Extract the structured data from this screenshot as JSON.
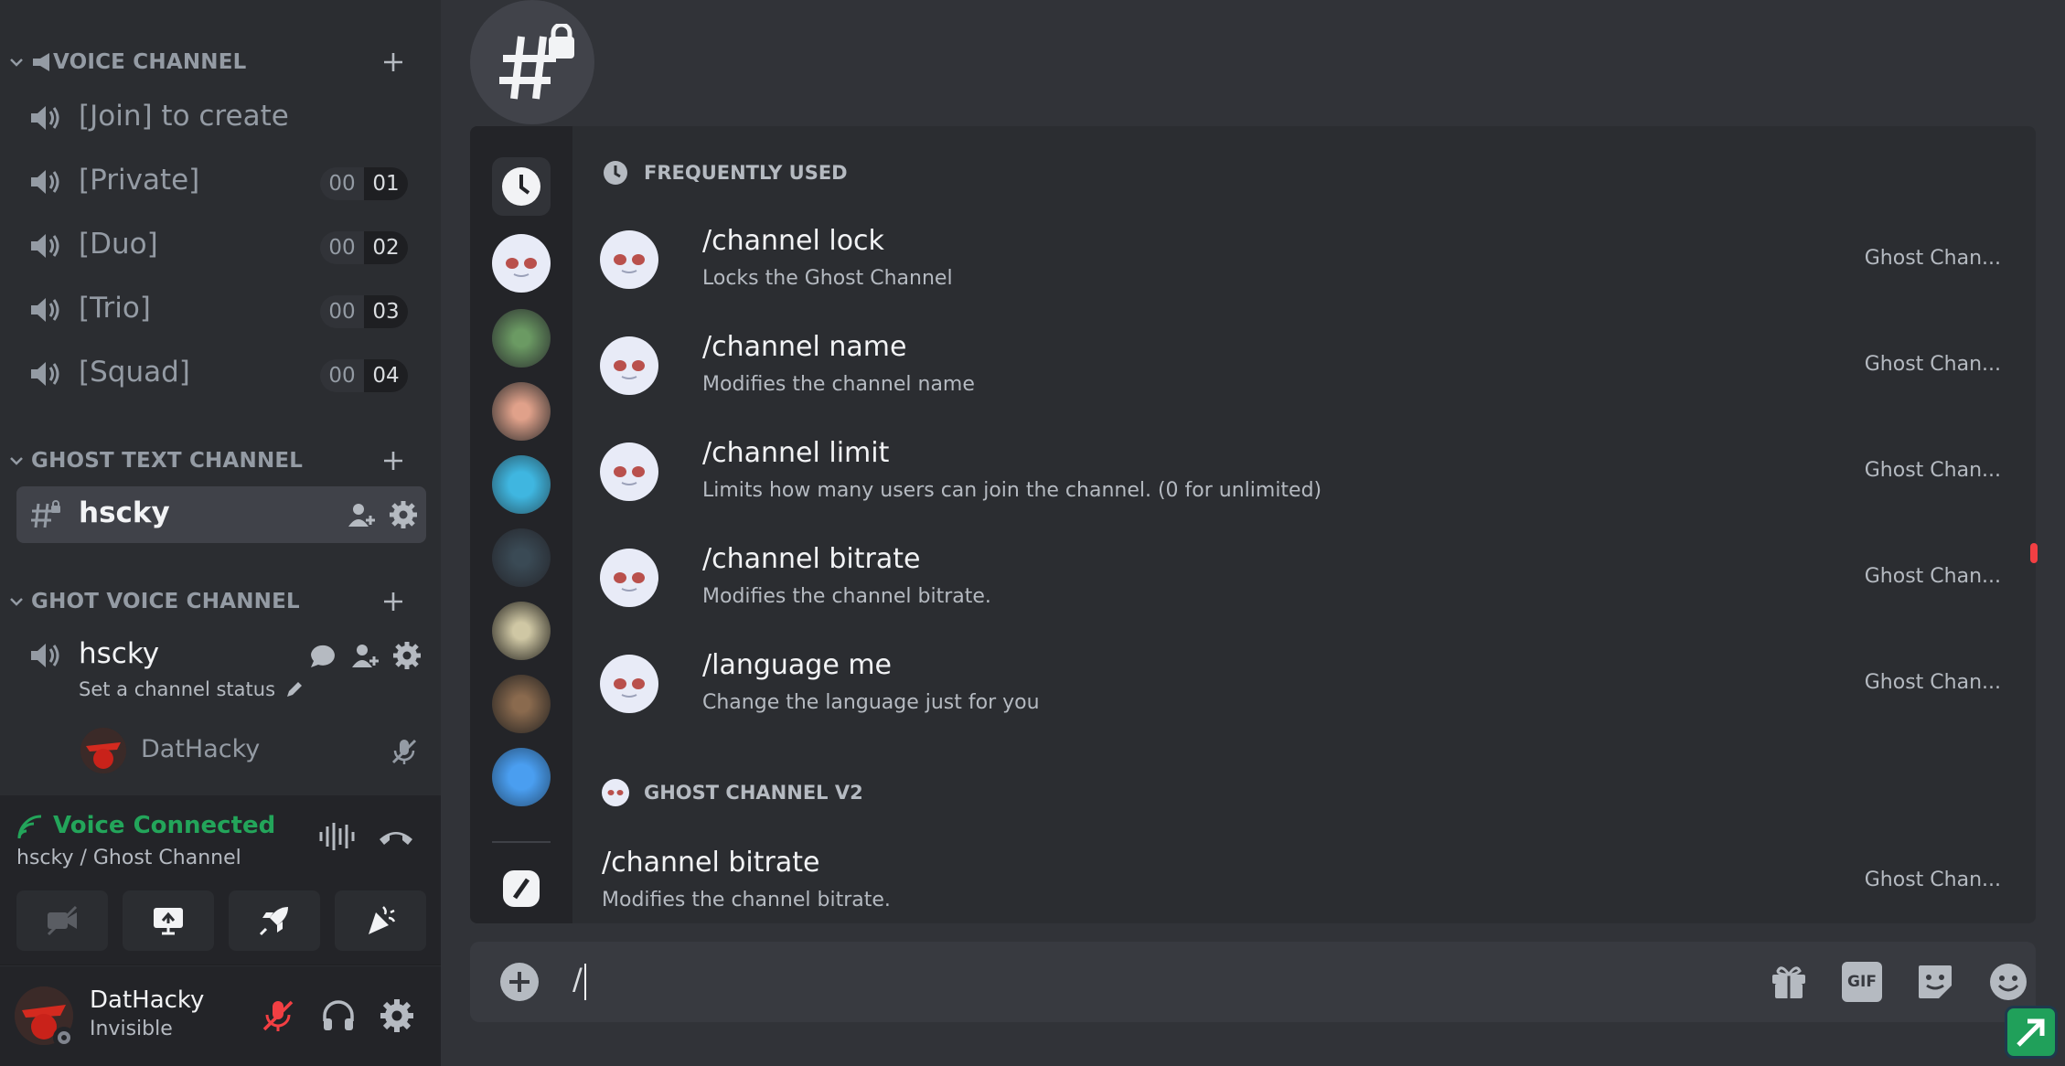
{
  "sidebar": {
    "categories": {
      "voice": "VOICE CHANNEL",
      "ghost_text": "GHOST TEXT CHANNEL",
      "ghost_voice": "GHOT VOICE CHANNEL"
    },
    "voice_channels": [
      {
        "name": "[Join] to create"
      },
      {
        "name": "[Private]",
        "count_a": "00",
        "count_b": "01"
      },
      {
        "name": "[Duo]",
        "count_a": "00",
        "count_b": "02"
      },
      {
        "name": "[Trio]",
        "count_a": "00",
        "count_b": "03"
      },
      {
        "name": "[Squad]",
        "count_a": "00",
        "count_b": "04"
      }
    ],
    "ghost_text_channel": {
      "name": "hscky"
    },
    "ghost_voice_channel": {
      "name": "hscky",
      "status_placeholder": "Set a channel status",
      "member": "DatHacky"
    }
  },
  "voice_panel": {
    "title": "Voice Connected",
    "subtitle": "hscky / Ghost Channel"
  },
  "user_panel": {
    "username": "DatHacky",
    "status": "Invisible"
  },
  "popup": {
    "section_frequent": "FREQUENTLY USED",
    "section_bot": "GHOST CHANNEL V2",
    "commands": [
      {
        "name": "/channel lock",
        "desc": "Locks the Ghost Channel",
        "source": "Ghost Chan..."
      },
      {
        "name": "/channel name",
        "desc": "Modifies the channel name",
        "source": "Ghost Chan..."
      },
      {
        "name": "/channel limit",
        "desc": "Limits how many users can join the channel. (0 for unlimited)",
        "source": "Ghost Chan..."
      },
      {
        "name": "/channel bitrate",
        "desc": "Modifies the channel bitrate.",
        "source": "Ghost Chan..."
      },
      {
        "name": "/language me",
        "desc": "Change the language just for you",
        "source": "Ghost Chan..."
      }
    ],
    "bot_commands": [
      {
        "name": "/channel bitrate",
        "desc": "Modifies the channel bitrate.",
        "source": "Ghost Chan..."
      }
    ]
  },
  "input": {
    "value": "/",
    "gif_label": "GIF"
  },
  "colors": {
    "background": "#313338",
    "sidebar": "#2b2d31",
    "voice_connected": "#23a55a",
    "muted_red": "#f23f43"
  }
}
